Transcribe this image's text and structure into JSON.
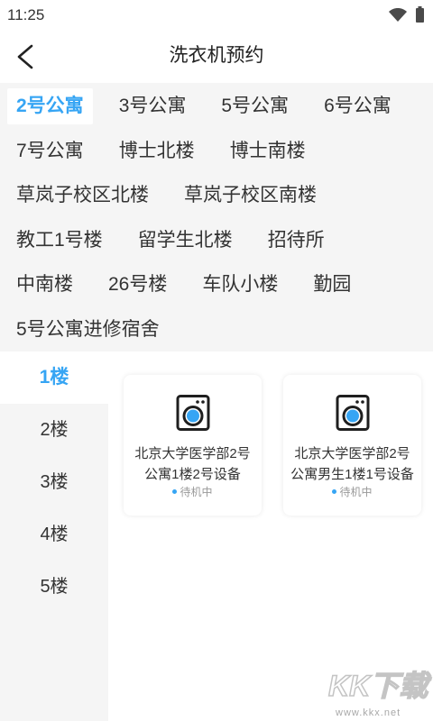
{
  "status_bar": {
    "time": "11:25",
    "icons": [
      "wifi-icon",
      "battery-icon"
    ]
  },
  "header": {
    "title": "洗衣机预约",
    "back_icon": "chevron-left-icon"
  },
  "buildings": {
    "selected_index": 0,
    "items": [
      "2号公寓",
      "3号公寓",
      "5号公寓",
      "6号公寓",
      "7号公寓",
      "博士北楼",
      "博士南楼",
      "草岚子校区北楼",
      "草岚子校区南楼",
      "教工1号楼",
      "留学生北楼",
      "招待所",
      "中南楼",
      "26号楼",
      "车队小楼",
      "勤园",
      "5号公寓进修宿舍"
    ]
  },
  "floors": {
    "selected_index": 0,
    "items": [
      "1楼",
      "2楼",
      "3楼",
      "4楼",
      "5楼"
    ]
  },
  "devices": [
    {
      "name": "北京大学医学部2号公寓1楼2号设备",
      "status": "待机中",
      "icon": "washing-machine-icon"
    },
    {
      "name": "北京大学医学部2号公寓男生1楼1号设备",
      "status": "待机中",
      "icon": "washing-machine-icon"
    }
  ],
  "colors": {
    "accent": "#36a5f4",
    "text": "#333333",
    "muted": "#999999",
    "panel_bg": "#f5f5f5"
  },
  "watermark": {
    "logo_text": "KK下载",
    "url": "www.kkx.net"
  }
}
